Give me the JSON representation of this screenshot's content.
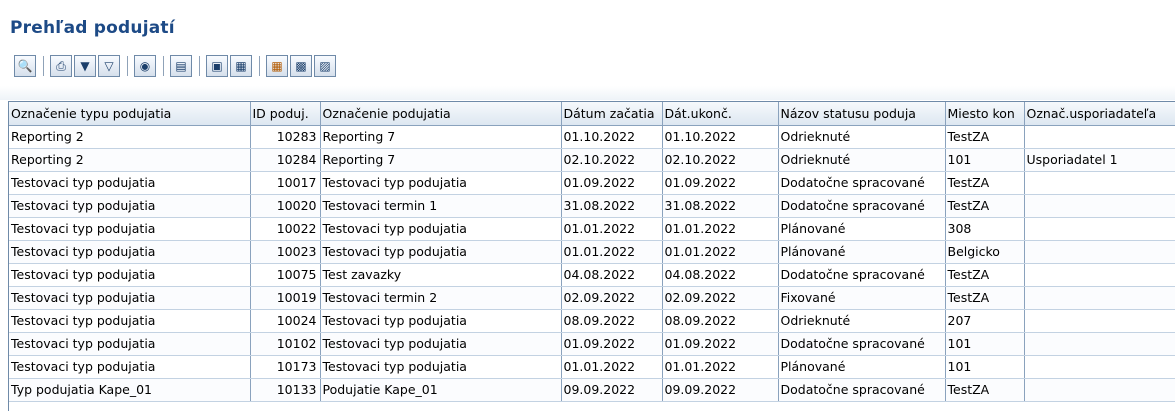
{
  "page": {
    "title": "Prehľad podujatí"
  },
  "toolbar": {
    "buttons": [
      {
        "icon": "details-magnifier-icon"
      },
      {
        "icon": "print-icon"
      },
      {
        "icon": "filter-icon"
      },
      {
        "icon": "filter-remove-icon"
      },
      {
        "icon": "find-icon"
      },
      {
        "icon": "export-icon"
      },
      {
        "icon": "select-layout-icon"
      },
      {
        "icon": "change-layout-icon"
      },
      {
        "icon": "grid-view-icon"
      },
      {
        "icon": "add-column-icon"
      },
      {
        "icon": "remove-column-icon"
      }
    ]
  },
  "table": {
    "columns": [
      "Označenie typu podujatia",
      "ID poduj.",
      "Označenie podujatia",
      "Dátum začatia",
      "Dát.ukonč.",
      "Názov statusu poduja",
      "Miesto kon",
      "Označ.usporiadateľa"
    ],
    "rows": [
      [
        "Reporting 2",
        "10283",
        "Reporting 7",
        "01.10.2022",
        "01.10.2022",
        "Odrieknuté",
        "TestZA",
        ""
      ],
      [
        "Reporting 2",
        "10284",
        "Reporting 7",
        "02.10.2022",
        "02.10.2022",
        "Odrieknuté",
        "101",
        "Usporiadatel 1"
      ],
      [
        "Testovaci typ podujatia",
        "10017",
        "Testovaci typ podujatia",
        "01.09.2022",
        "01.09.2022",
        "Dodatočne spracované",
        "TestZA",
        ""
      ],
      [
        "Testovaci typ podujatia",
        "10020",
        "Testovaci termin 1",
        "31.08.2022",
        "31.08.2022",
        "Dodatočne spracované",
        "TestZA",
        ""
      ],
      [
        "Testovaci typ podujatia",
        "10022",
        "Testovaci typ podujatia",
        "01.01.2022",
        "01.01.2022",
        "Plánované",
        "308",
        ""
      ],
      [
        "Testovaci typ podujatia",
        "10023",
        "Testovaci typ podujatia",
        "01.01.2022",
        "01.01.2022",
        "Plánované",
        "Belgicko",
        ""
      ],
      [
        "Testovaci typ podujatia",
        "10075",
        "Test zavazky",
        "04.08.2022",
        "04.08.2022",
        "Dodatočne spracované",
        "TestZA",
        ""
      ],
      [
        "Testovaci typ podujatia",
        "10019",
        "Testovaci termin 2",
        "02.09.2022",
        "02.09.2022",
        "Fixované",
        "TestZA",
        ""
      ],
      [
        "Testovaci typ podujatia",
        "10024",
        "Testovaci typ podujatia",
        "08.09.2022",
        "08.09.2022",
        "Odrieknuté",
        "207",
        ""
      ],
      [
        "Testovaci typ podujatia",
        "10102",
        "Testovaci typ podujatia",
        "01.09.2022",
        "01.09.2022",
        "Dodatočne spracované",
        "101",
        ""
      ],
      [
        "Testovaci typ podujatia",
        "10173",
        "Testovaci typ podujatia",
        "01.01.2022",
        "01.01.2022",
        "Plánované",
        "101",
        ""
      ],
      [
        "Typ podujatia Kape_01",
        "10133",
        "Podujatie Kape_01",
        "09.09.2022",
        "09.09.2022",
        "Dodatočne spracované",
        "TestZA",
        ""
      ]
    ]
  }
}
